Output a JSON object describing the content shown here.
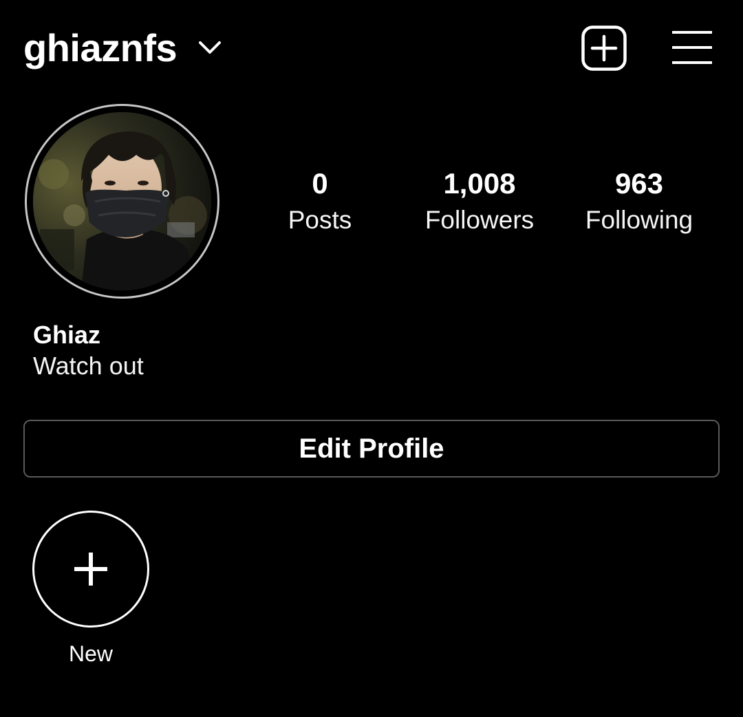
{
  "header": {
    "username": "ghiaznfs",
    "username_dropdown_icon": "chevron-down-icon",
    "new_post_icon": "plus-square-icon",
    "menu_icon": "hamburger-menu-icon"
  },
  "profile": {
    "avatar": "profile-photo",
    "stats": [
      {
        "value": "0",
        "label": "Posts"
      },
      {
        "value": "1,008",
        "label": "Followers"
      },
      {
        "value": "963",
        "label": "Following"
      }
    ],
    "display_name": "Ghiaz",
    "bio": "Watch out"
  },
  "actions": {
    "edit_profile_label": "Edit Profile"
  },
  "highlights": {
    "new_label": "New",
    "new_icon": "plus-icon"
  },
  "colors": {
    "background": "#000000",
    "text": "#ffffff",
    "button_border": "#5a5a5a",
    "avatar_ring": "#c7c7c7"
  }
}
